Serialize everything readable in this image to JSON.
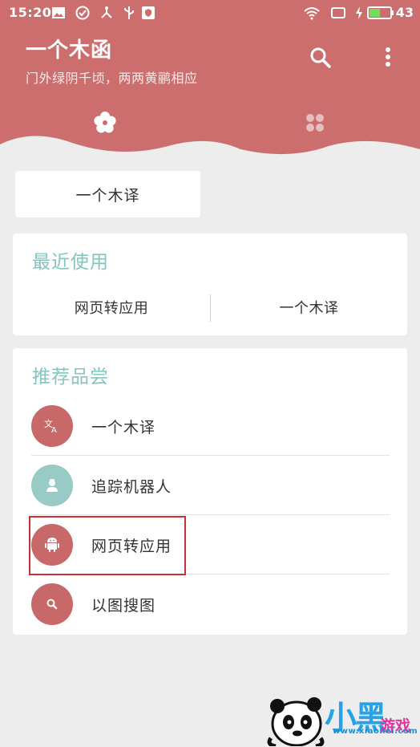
{
  "status_bar": {
    "time": "15:20",
    "battery": "43",
    "icons": [
      "image-icon",
      "check-circle-icon",
      "share-icon",
      "usb-icon",
      "shield-icon",
      "wifi-icon",
      "screen-icon",
      "charging-icon",
      "battery-icon"
    ]
  },
  "header": {
    "title": "一个木函",
    "subtitle": "门外绿阴千顷，两两黄鹂相应",
    "background_color": "#cc6e6e",
    "actions": [
      "search-icon",
      "more-vert-icon"
    ],
    "tabs": [
      "flower-icon",
      "grid-icon"
    ]
  },
  "top_button": {
    "label": "一个木译"
  },
  "recent": {
    "title": "最近使用",
    "items": [
      "网页转应用",
      "一个木译"
    ]
  },
  "recommended": {
    "title": "推荐品尝",
    "items": [
      {
        "label": "一个木译",
        "icon": "translate-icon",
        "color": "#c96868"
      },
      {
        "label": "追踪机器人",
        "icon": "robot-person-icon",
        "color": "#98cbc6"
      },
      {
        "label": "网页转应用",
        "icon": "android-icon",
        "color": "#c96868"
      },
      {
        "label": "以图搜图",
        "icon": "search-icon",
        "color": "#c96868"
      }
    ]
  },
  "accent_color": "#86c4bd",
  "watermark": {
    "big": "小黑",
    "small": "游戏",
    "url": "www.xiaohei.com"
  }
}
